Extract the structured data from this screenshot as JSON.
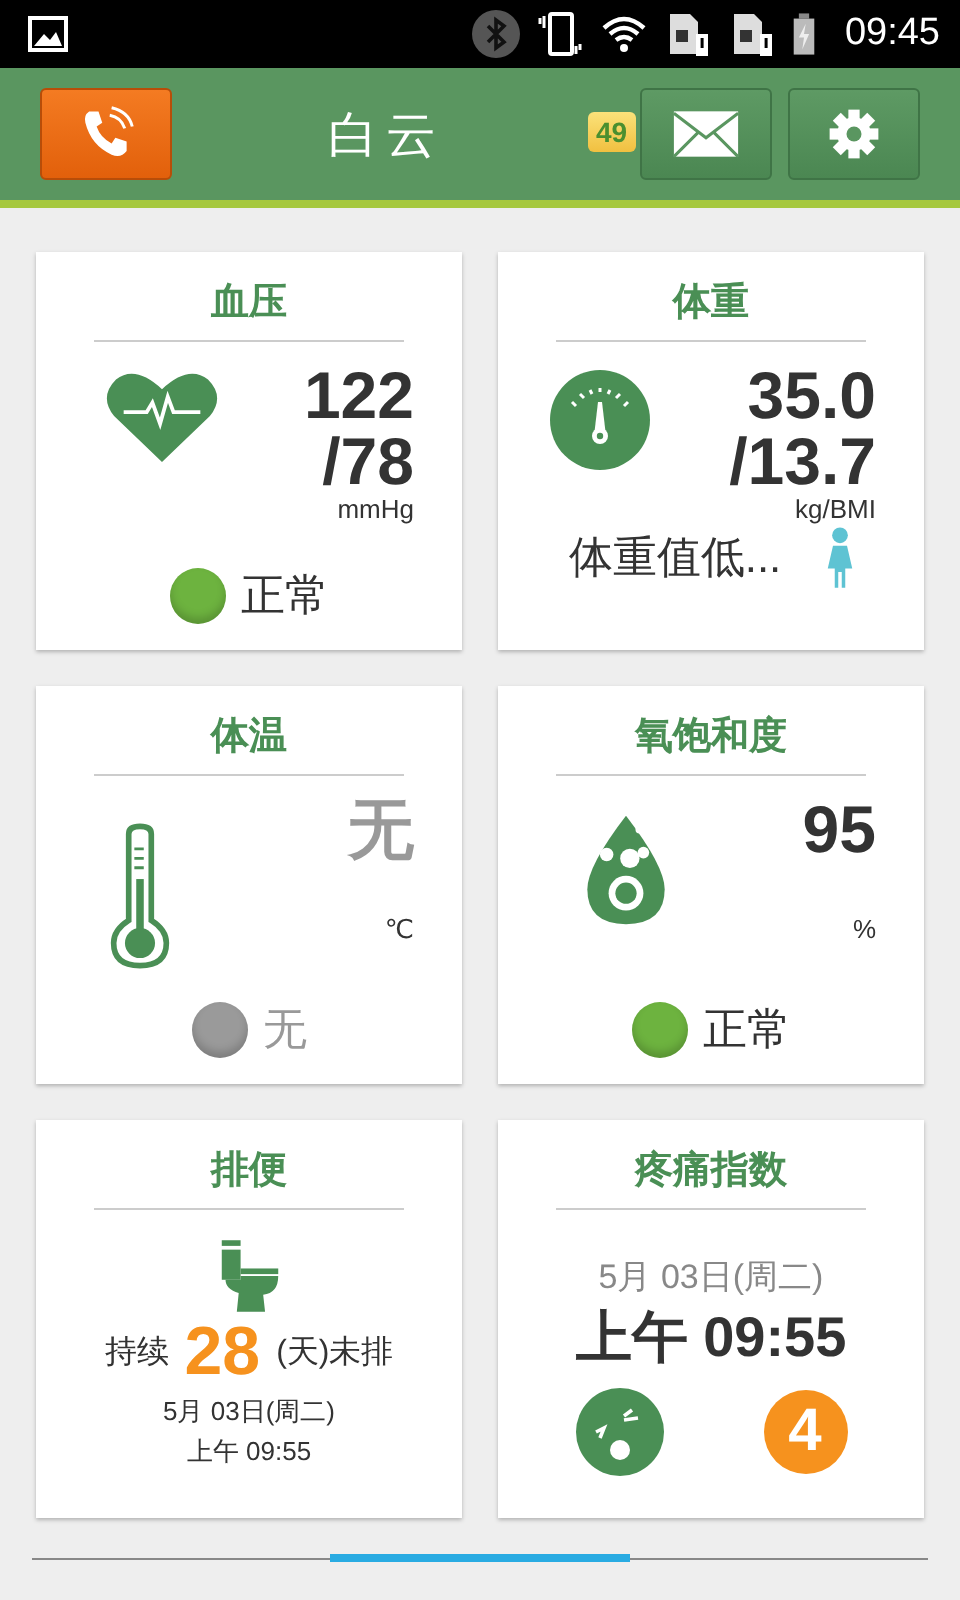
{
  "status_bar": {
    "time": "09:45"
  },
  "header": {
    "title": "白云",
    "message_count": "49"
  },
  "cards": [
    {
      "kind": "blood_pressure",
      "title": "血压",
      "values": [
        "122",
        "/78"
      ],
      "unit": "mmHg",
      "muted": false,
      "status": {
        "text": "正常",
        "color": "#6db33f"
      }
    },
    {
      "kind": "weight",
      "title": "体重",
      "values": [
        "35.0",
        "/13.7"
      ],
      "unit": "kg/BMI",
      "muted": false,
      "note": "体重值低..."
    },
    {
      "kind": "temperature",
      "title": "体温",
      "values": [
        "无"
      ],
      "unit": "℃",
      "muted": true,
      "status": {
        "text": "无",
        "color": "#9a9a9a"
      }
    },
    {
      "kind": "oxygen",
      "title": "氧饱和度",
      "values": [
        "95"
      ],
      "unit": "%",
      "muted": false,
      "status": {
        "text": "正常",
        "color": "#6db33f"
      }
    },
    {
      "kind": "bowel",
      "title": "排便",
      "prefix": "持续",
      "days": "28",
      "suffix": "(天)未排",
      "date": "5月 03日(周二)",
      "time": "上午 09:55"
    },
    {
      "kind": "pain",
      "title": "疼痛指数",
      "date": "5月 03日(周二)",
      "time": "上午 09:55",
      "score": "4"
    }
  ]
}
